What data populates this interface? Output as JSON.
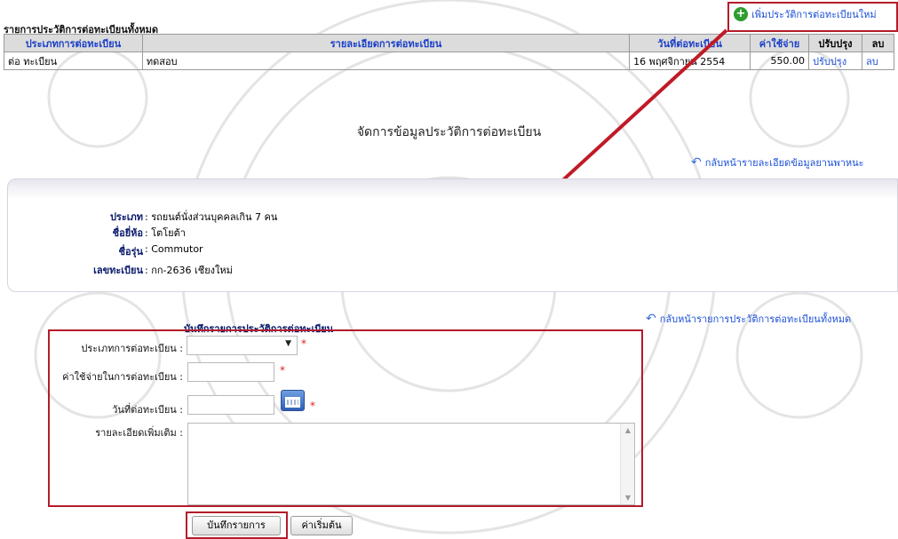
{
  "history": {
    "title": "รายการประวัติการต่อทะเบียนทั้งหมด",
    "add_label": "เพิ่มประวัติการต่อทะเบียนใหม่",
    "columns": [
      "ประเภทการต่อทะเบียน",
      "รายละเอียดการต่อทะเบียน",
      "วันที่ต่อทะเบียน",
      "ค่าใช้จ่าย",
      "ปรับปรุง",
      "ลบ"
    ],
    "rows": [
      {
        "type": "ต่อ ทะเบียน",
        "detail": "ทดสอบ",
        "date": "16 พฤศจิกายน 2554",
        "cost": "550.00",
        "edit": "ปรับปรุง",
        "delete": "ลบ"
      }
    ]
  },
  "section_title": "จัดการข้อมูลประวัติการต่อทะเบียน",
  "back_to_vehicle": "กลับหน้ารายละเอียดข้อมูลยานพาหนะ",
  "vehicle": {
    "type_label": "ประเภท",
    "type_value": "รถยนต์นั่งส่วนบุคคลเกิน 7 คน",
    "brand_label": "ชื่อยี่ห้อ",
    "brand_value": "โตโยต้า",
    "model_label": "ชื่อรุ่น",
    "model_value": "Commutor",
    "plate_label": "เลขทะเบียน",
    "plate_value": "กก-2636 เชียงใหม่"
  },
  "back_to_list": "กลับหน้ารายการประวัติการต่อทะเบียนทั้งหมด",
  "form": {
    "title": "บันทึกรายการประวัติการต่อทะเบียน",
    "type_label": "ประเภทการต่อทะเบียน :",
    "type_value": "",
    "cost_label": "ค่าใช้จ่ายในการต่อทะเบียน :",
    "cost_value": "",
    "date_label": "วันที่ต่อทะเบียน :",
    "date_value": "",
    "detail_label": "รายละเอียดเพิ่มเติม :",
    "detail_value": "",
    "required_mark": "*",
    "save_label": "บันทึกรายการ",
    "reset_label": "ค่าเริ่มต้น"
  },
  "colors": {
    "link": "#1a4fd6",
    "annotation_red": "#b41c2b",
    "label_navy": "#0a1a6b"
  }
}
